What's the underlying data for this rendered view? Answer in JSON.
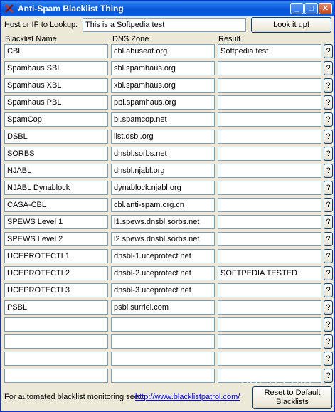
{
  "window": {
    "title": "Anti-Spam Blacklist Thing"
  },
  "lookup": {
    "label": "Host or IP to Lookup:",
    "value": "This is a Softpedia test",
    "button": "Look it up!"
  },
  "columns": {
    "name": "Blacklist Name",
    "zone": "DNS Zone",
    "result": "Result"
  },
  "help_button_label": "?",
  "rows": [
    {
      "name": "CBL",
      "zone": "cbl.abuseat.org",
      "result": "Softpedia test"
    },
    {
      "name": "Spamhaus SBL",
      "zone": "sbl.spamhaus.org",
      "result": ""
    },
    {
      "name": "Spamhaus XBL",
      "zone": "xbl.spamhaus.org",
      "result": ""
    },
    {
      "name": "Spamhaus PBL",
      "zone": "pbl.spamhaus.org",
      "result": ""
    },
    {
      "name": "SpamCop",
      "zone": "bl.spamcop.net",
      "result": ""
    },
    {
      "name": "DSBL",
      "zone": "list.dsbl.org",
      "result": ""
    },
    {
      "name": "SORBS",
      "zone": "dnsbl.sorbs.net",
      "result": ""
    },
    {
      "name": "NJABL",
      "zone": "dnsbl.njabl.org",
      "result": ""
    },
    {
      "name": "NJABL Dynablock",
      "zone": "dynablock.njabl.org",
      "result": ""
    },
    {
      "name": "CASA-CBL",
      "zone": "cbl.anti-spam.org.cn",
      "result": ""
    },
    {
      "name": "SPEWS Level 1",
      "zone": "l1.spews.dnsbl.sorbs.net",
      "result": ""
    },
    {
      "name": "SPEWS Level 2",
      "zone": "l2.spews.dnsbl.sorbs.net",
      "result": ""
    },
    {
      "name": "UCEPROTECTL1",
      "zone": "dnsbl-1.uceprotect.net",
      "result": ""
    },
    {
      "name": "UCEPROTECTL2",
      "zone": "dnsbl-2.uceprotect.net",
      "result": "SOFTPEDIA TESTED"
    },
    {
      "name": "UCEPROTECTL3",
      "zone": "dnsbl-3.uceprotect.net",
      "result": ""
    },
    {
      "name": "PSBL",
      "zone": "psbl.surriel.com",
      "result": ""
    },
    {
      "name": "",
      "zone": "",
      "result": ""
    },
    {
      "name": "",
      "zone": "",
      "result": ""
    },
    {
      "name": "",
      "zone": "",
      "result": ""
    },
    {
      "name": "",
      "zone": "",
      "result": ""
    }
  ],
  "footer": {
    "text": "For automated blacklist monitoring see:",
    "link": "http://www.blacklistpatrol.com/",
    "reset_button": "Reset to Default Blacklists"
  },
  "watermark": "SOFTPEDIA"
}
